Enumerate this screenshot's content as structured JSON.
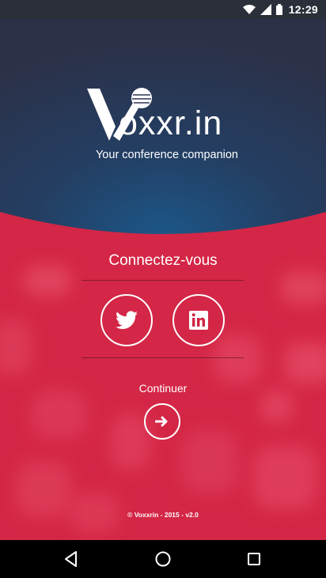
{
  "status_bar": {
    "time": "12:29",
    "icons": [
      "wifi-icon",
      "signal-icon",
      "battery-icon"
    ]
  },
  "brand": {
    "name": "Voxxr.in",
    "logo_text": "oxxr.in",
    "tagline": "Your conference companion"
  },
  "login": {
    "title": "Connectez-vous",
    "providers": [
      {
        "name": "twitter",
        "icon": "twitter-icon"
      },
      {
        "name": "linkedin",
        "icon": "linkedin-icon"
      }
    ]
  },
  "continue": {
    "label": "Continuer",
    "icon": "arrow-right-icon"
  },
  "footer": {
    "text": "© Voxxrin - 2015 - v2.0"
  },
  "nav_bar": {
    "buttons": [
      "back-icon",
      "home-icon",
      "recent-apps-icon"
    ]
  },
  "colors": {
    "header_dark": "#2a3148",
    "header_blue": "#1e4a73",
    "accent_red": "#d32443",
    "status_bar": "#2b2f3a"
  }
}
